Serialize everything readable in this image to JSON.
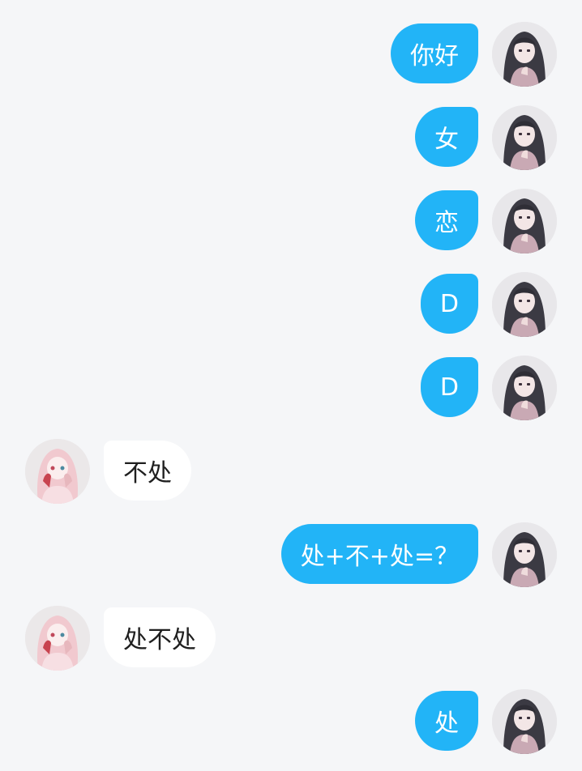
{
  "chat": {
    "messages": [
      {
        "sender": "self",
        "text": "你好"
      },
      {
        "sender": "self",
        "text": "女"
      },
      {
        "sender": "self",
        "text": "恋"
      },
      {
        "sender": "self",
        "text": "D"
      },
      {
        "sender": "self",
        "text": "D"
      },
      {
        "sender": "other",
        "text": "不处"
      },
      {
        "sender": "self",
        "text": "处+不+处=？"
      },
      {
        "sender": "other",
        "text": "处不处"
      },
      {
        "sender": "self",
        "text": "处"
      }
    ]
  },
  "colors": {
    "background": "#f5f6f8",
    "self_bubble": "#22b4f7",
    "self_text": "#ffffff",
    "other_bubble": "#ffffff",
    "other_text": "#1f1f1f"
  },
  "icons": {
    "self_avatar": "dark-haired-girl-avatar",
    "other_avatar": "pink-haired-girl-avatar"
  }
}
